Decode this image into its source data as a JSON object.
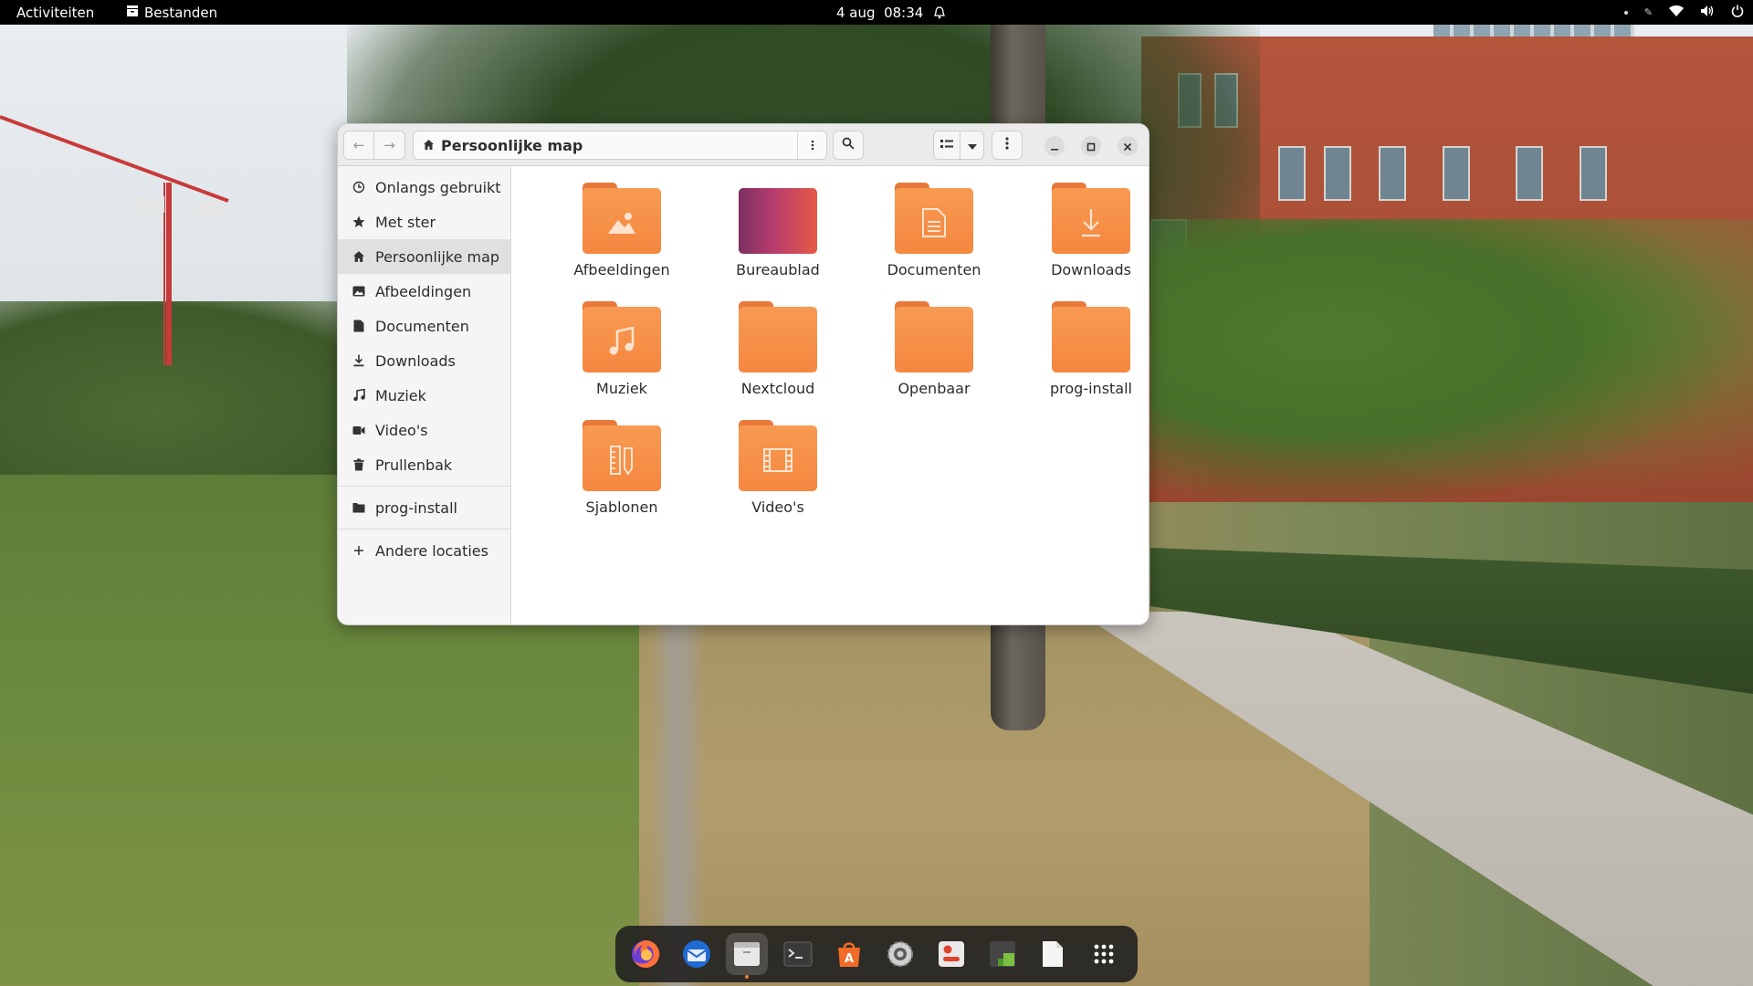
{
  "topbar": {
    "activities": "Activiteiten",
    "app_name": "Bestanden",
    "clock": "4 aug  08:34"
  },
  "window": {
    "path_label": "Persoonlijke map"
  },
  "sidebar": {
    "items": [
      {
        "label": "Onlangs gebruikt",
        "icon": "clock-icon"
      },
      {
        "label": "Met ster",
        "icon": "star-icon"
      },
      {
        "label": "Persoonlijke map",
        "icon": "home-icon",
        "active": true
      },
      {
        "label": "Afbeeldingen",
        "icon": "image-icon"
      },
      {
        "label": "Documenten",
        "icon": "document-icon"
      },
      {
        "label": "Downloads",
        "icon": "download-icon"
      },
      {
        "label": "Muziek",
        "icon": "music-icon"
      },
      {
        "label": "Video's",
        "icon": "video-icon"
      },
      {
        "label": "Prullenbak",
        "icon": "trash-icon"
      }
    ],
    "bookmarks": [
      {
        "label": "prog-install",
        "icon": "folder-icon"
      }
    ],
    "other": {
      "label": "Andere locaties",
      "icon": "plus-icon"
    }
  },
  "folders": [
    {
      "name": "Afbeeldingen",
      "icon": "image-icon"
    },
    {
      "name": "Bureaublad",
      "icon": "desktop-icon"
    },
    {
      "name": "Documenten",
      "icon": "document-icon"
    },
    {
      "name": "Downloads",
      "icon": "download-icon"
    },
    {
      "name": "Muziek",
      "icon": "music-icon"
    },
    {
      "name": "Nextcloud",
      "icon": "folder-icon"
    },
    {
      "name": "Openbaar",
      "icon": "folder-icon"
    },
    {
      "name": "prog-install",
      "icon": "folder-icon"
    },
    {
      "name": "Sjablonen",
      "icon": "template-icon"
    },
    {
      "name": "Video's",
      "icon": "video-icon"
    }
  ],
  "dock": [
    {
      "app": "firefox-icon"
    },
    {
      "app": "thunderbird-icon"
    },
    {
      "app": "files-icon",
      "active": true
    },
    {
      "app": "terminal-icon"
    },
    {
      "app": "software-center-icon"
    },
    {
      "app": "settings-icon"
    },
    {
      "app": "tweaks-icon"
    },
    {
      "app": "system-monitor-icon"
    },
    {
      "app": "text-editor-icon"
    },
    {
      "app": "app-grid-icon"
    }
  ],
  "colors": {
    "folder": "#f5873f",
    "folder_tab": "#e9793a",
    "accent_active_dot": "#f57a2e"
  }
}
